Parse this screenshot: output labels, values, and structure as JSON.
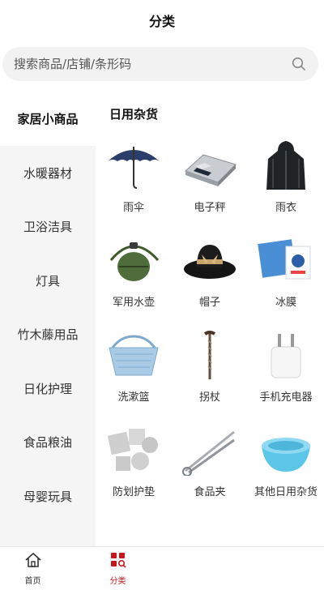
{
  "header": {
    "title": "分类"
  },
  "search": {
    "placeholder": "搜索商品/店铺/条形码"
  },
  "sidebar": {
    "items": [
      {
        "label": "家居小商品",
        "active": true
      },
      {
        "label": "水暖器材",
        "active": false
      },
      {
        "label": "卫浴洁具",
        "active": false
      },
      {
        "label": "灯具",
        "active": false
      },
      {
        "label": "竹木藤用品",
        "active": false
      },
      {
        "label": "日化护理",
        "active": false
      },
      {
        "label": "食品粮油",
        "active": false
      },
      {
        "label": "母婴玩具",
        "active": false
      }
    ]
  },
  "content": {
    "section_title": "日用杂货",
    "products": [
      {
        "label": "雨伞",
        "icon": "umbrella-image"
      },
      {
        "label": "电子秤",
        "icon": "scale-image"
      },
      {
        "label": "雨衣",
        "icon": "raincoat-image"
      },
      {
        "label": "军用水壶",
        "icon": "canteen-image"
      },
      {
        "label": "帽子",
        "icon": "hat-image"
      },
      {
        "label": "冰膜",
        "icon": "ice-pack-image"
      },
      {
        "label": "洗漱篮",
        "icon": "basket-image"
      },
      {
        "label": "拐杖",
        "icon": "cane-image"
      },
      {
        "label": "手机充电器",
        "icon": "charger-image"
      },
      {
        "label": "防划护垫",
        "icon": "felt-pads-image"
      },
      {
        "label": "食品夹",
        "icon": "tongs-image"
      },
      {
        "label": "其他日用杂货",
        "icon": "bowl-image"
      }
    ]
  },
  "bottom_nav": {
    "items": [
      {
        "label": "首页",
        "icon": "home-icon"
      },
      {
        "label": "分类",
        "icon": "category-icon",
        "active": true
      }
    ]
  },
  "colors": {
    "accent": "#c8161d",
    "sidebar_bg": "#f5f5f5",
    "search_bg": "#f2f2f2"
  }
}
